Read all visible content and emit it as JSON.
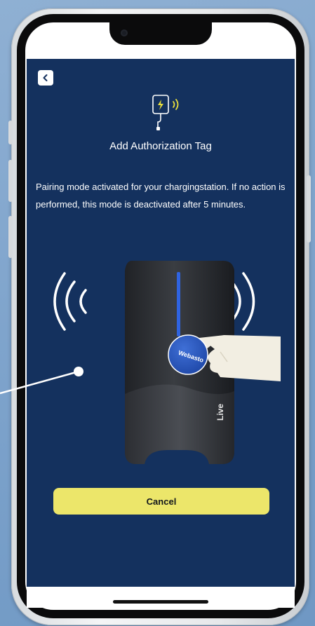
{
  "header": {
    "back_label": "<"
  },
  "main": {
    "icon": "wallbox-nfc-icon",
    "title": "Add Authorization Tag",
    "message": "Pairing mode activated for your chargingstation. If no action is performed, this mode is deactivated after 5 minutes.",
    "illustration": {
      "device_label": "Live",
      "tag_brand": "Webasto"
    },
    "cancel_label": "Cancel"
  },
  "colors": {
    "app_background": "#14315e",
    "accent": "#ece66a",
    "icon_yellow": "#e9df3c"
  }
}
